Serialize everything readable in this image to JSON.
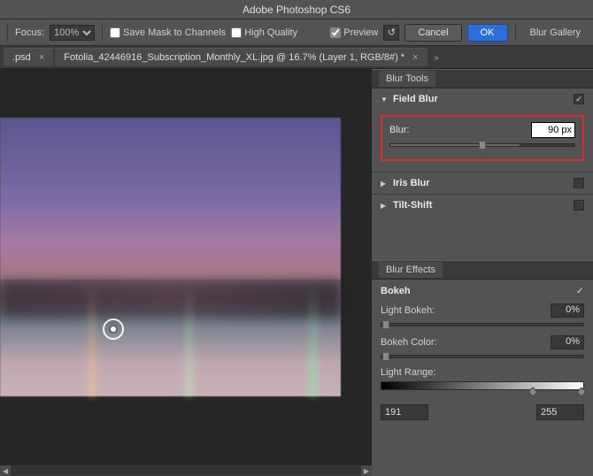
{
  "app": {
    "title": "Adobe Photoshop CS6"
  },
  "options": {
    "focus_label": "Focus:",
    "focus_value": "100%",
    "save_mask": "Save Mask to Channels",
    "high_quality": "High Quality",
    "preview": "Preview",
    "cancel": "Cancel",
    "ok": "OK",
    "blur_gallery": "Blur Gallery"
  },
  "tabs": {
    "t1": ".psd",
    "t2": "Fotolia_42446916_Subscription_Monthly_XL.jpg @ 16.7% (Layer 1, RGB/8#) *"
  },
  "panel1": {
    "title": "Blur Tools",
    "field_blur": {
      "title": "Field Blur",
      "blur_label": "Blur:",
      "blur_value": "90 px",
      "checked": true
    },
    "iris_blur": {
      "title": "Iris Blur",
      "checked": false
    },
    "tilt_shift": {
      "title": "Tilt-Shift",
      "checked": false
    }
  },
  "panel2": {
    "title": "Blur Effects",
    "bokeh": {
      "title": "Bokeh",
      "checked": true
    },
    "light_bokeh": {
      "label": "Light Bokeh:",
      "value": "0%"
    },
    "bokeh_color": {
      "label": "Bokeh Color:",
      "value": "0%"
    },
    "light_range": {
      "label": "Light Range:",
      "low": "191",
      "high": "255"
    }
  }
}
